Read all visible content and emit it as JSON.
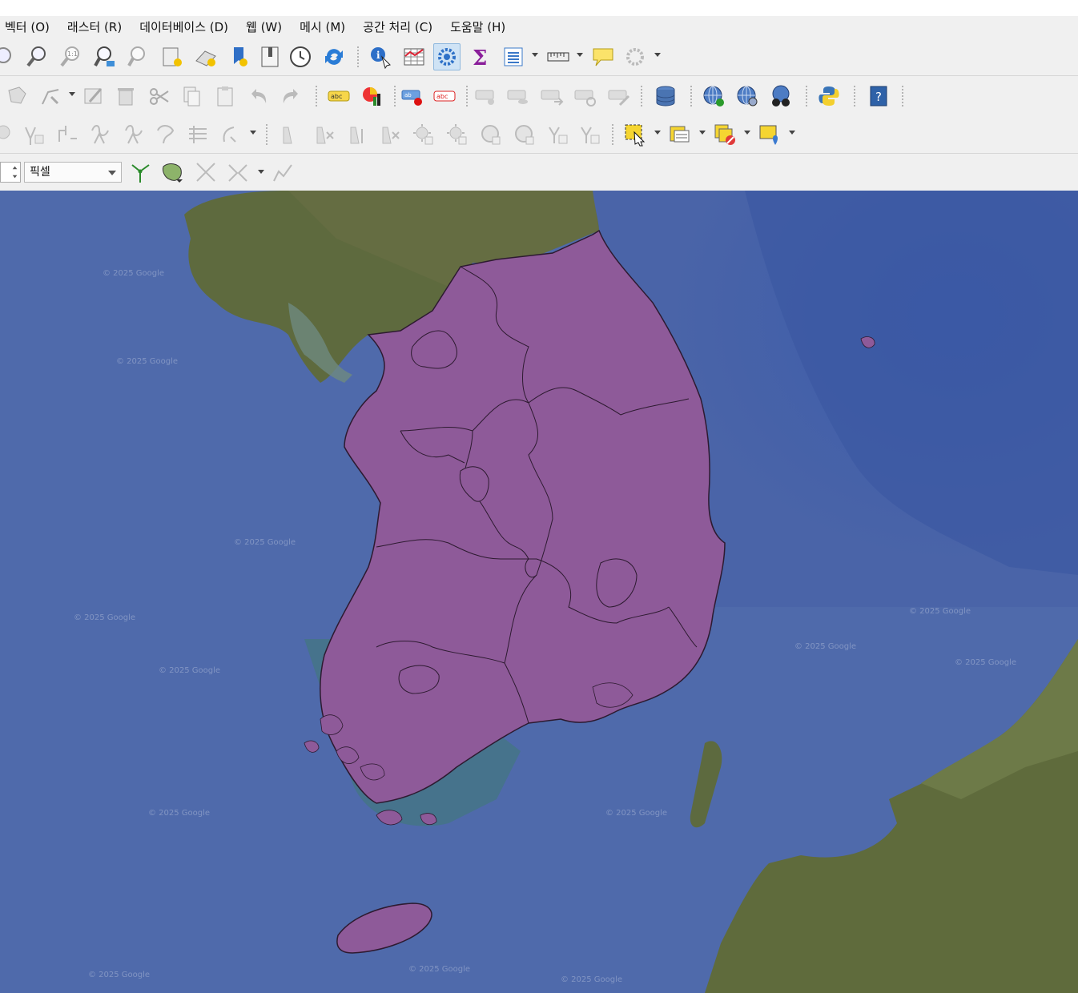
{
  "menubar": {
    "items": [
      "벡터 (O)",
      "래스터 (R)",
      "데이터베이스 (D)",
      "웹 (W)",
      "메시 (M)",
      "공간 처리 (C)",
      "도움말 (H)"
    ]
  },
  "snapping": {
    "unit_value": "픽셀"
  },
  "map": {
    "basemap_attribution": "© 2025 Google",
    "colors": {
      "sea": "#3b5aa0",
      "land": "#5f6a3e",
      "polygon_fill": "#8e5a99",
      "polygon_stroke": "#2d1a30"
    }
  }
}
